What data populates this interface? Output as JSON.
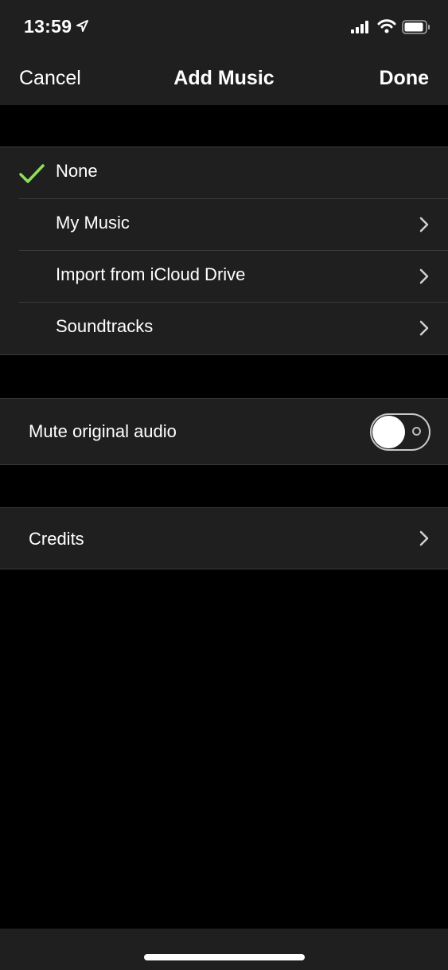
{
  "status_bar": {
    "time": "13:59"
  },
  "nav": {
    "cancel": "Cancel",
    "title": "Add Music",
    "done": "Done"
  },
  "music_options": [
    {
      "label": "None",
      "selected": true
    },
    {
      "label": "My Music"
    },
    {
      "label": "Import from iCloud Drive"
    },
    {
      "label": "Soundtracks"
    }
  ],
  "mute": {
    "label": "Mute original audio",
    "enabled": false
  },
  "credits": {
    "label": "Credits"
  },
  "colors": {
    "accent": "#8ee05a",
    "background": "#000000",
    "cell": "#1f1f1f"
  }
}
